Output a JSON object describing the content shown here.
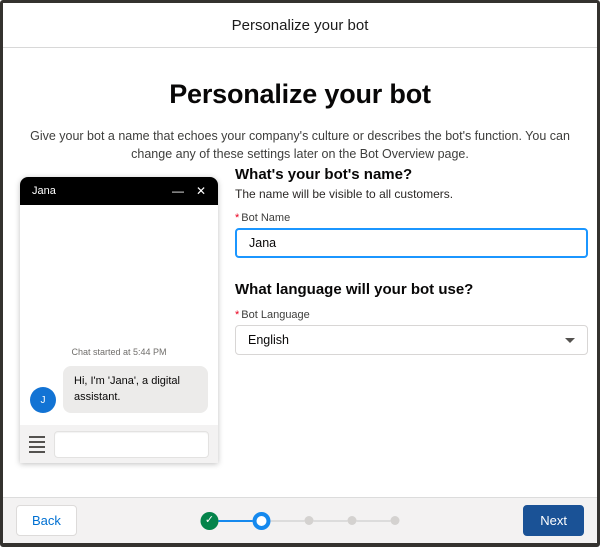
{
  "modal": {
    "header_title": "Personalize your bot"
  },
  "intro": {
    "title": "Personalize your bot",
    "subtitle": "Give your bot a name that echoes your company's culture or describes the bot's function. You can change any of these settings later on the Bot Overview page."
  },
  "chat_preview": {
    "title": "Jana",
    "minimize_icon": "—",
    "close_icon": "✕",
    "status_text": "Chat started at 5:44 PM",
    "avatar_initial": "J",
    "message": "Hi, I'm 'Jana', a digital assistant."
  },
  "form": {
    "name_section": {
      "heading": "What's your bot's name?",
      "description": "The name will be visible to all customers.",
      "required_marker": "*",
      "label": "Bot Name",
      "value": "Jana"
    },
    "language_section": {
      "heading": "What language will your bot use?",
      "required_marker": "*",
      "label": "Bot Language",
      "value": "English"
    }
  },
  "footer": {
    "back_label": "Back",
    "next_label": "Next",
    "progress": {
      "total_steps": 5,
      "current_step": 2,
      "check_icon": "✓",
      "steps": [
        {
          "state": "complete"
        },
        {
          "state": "active"
        },
        {
          "state": "incomplete"
        },
        {
          "state": "incomplete"
        },
        {
          "state": "incomplete"
        }
      ]
    }
  },
  "colors": {
    "accent_input_blue": "#1b96ff",
    "link_blue": "#0070d2",
    "next_button_navy": "#1a5296",
    "success_green": "#04844b",
    "progress_active_blue": "#1589ee",
    "progress_inactive_gray": "#dcdcdc",
    "avatar_blue": "#1273d4",
    "required_red": "#ea001e"
  }
}
